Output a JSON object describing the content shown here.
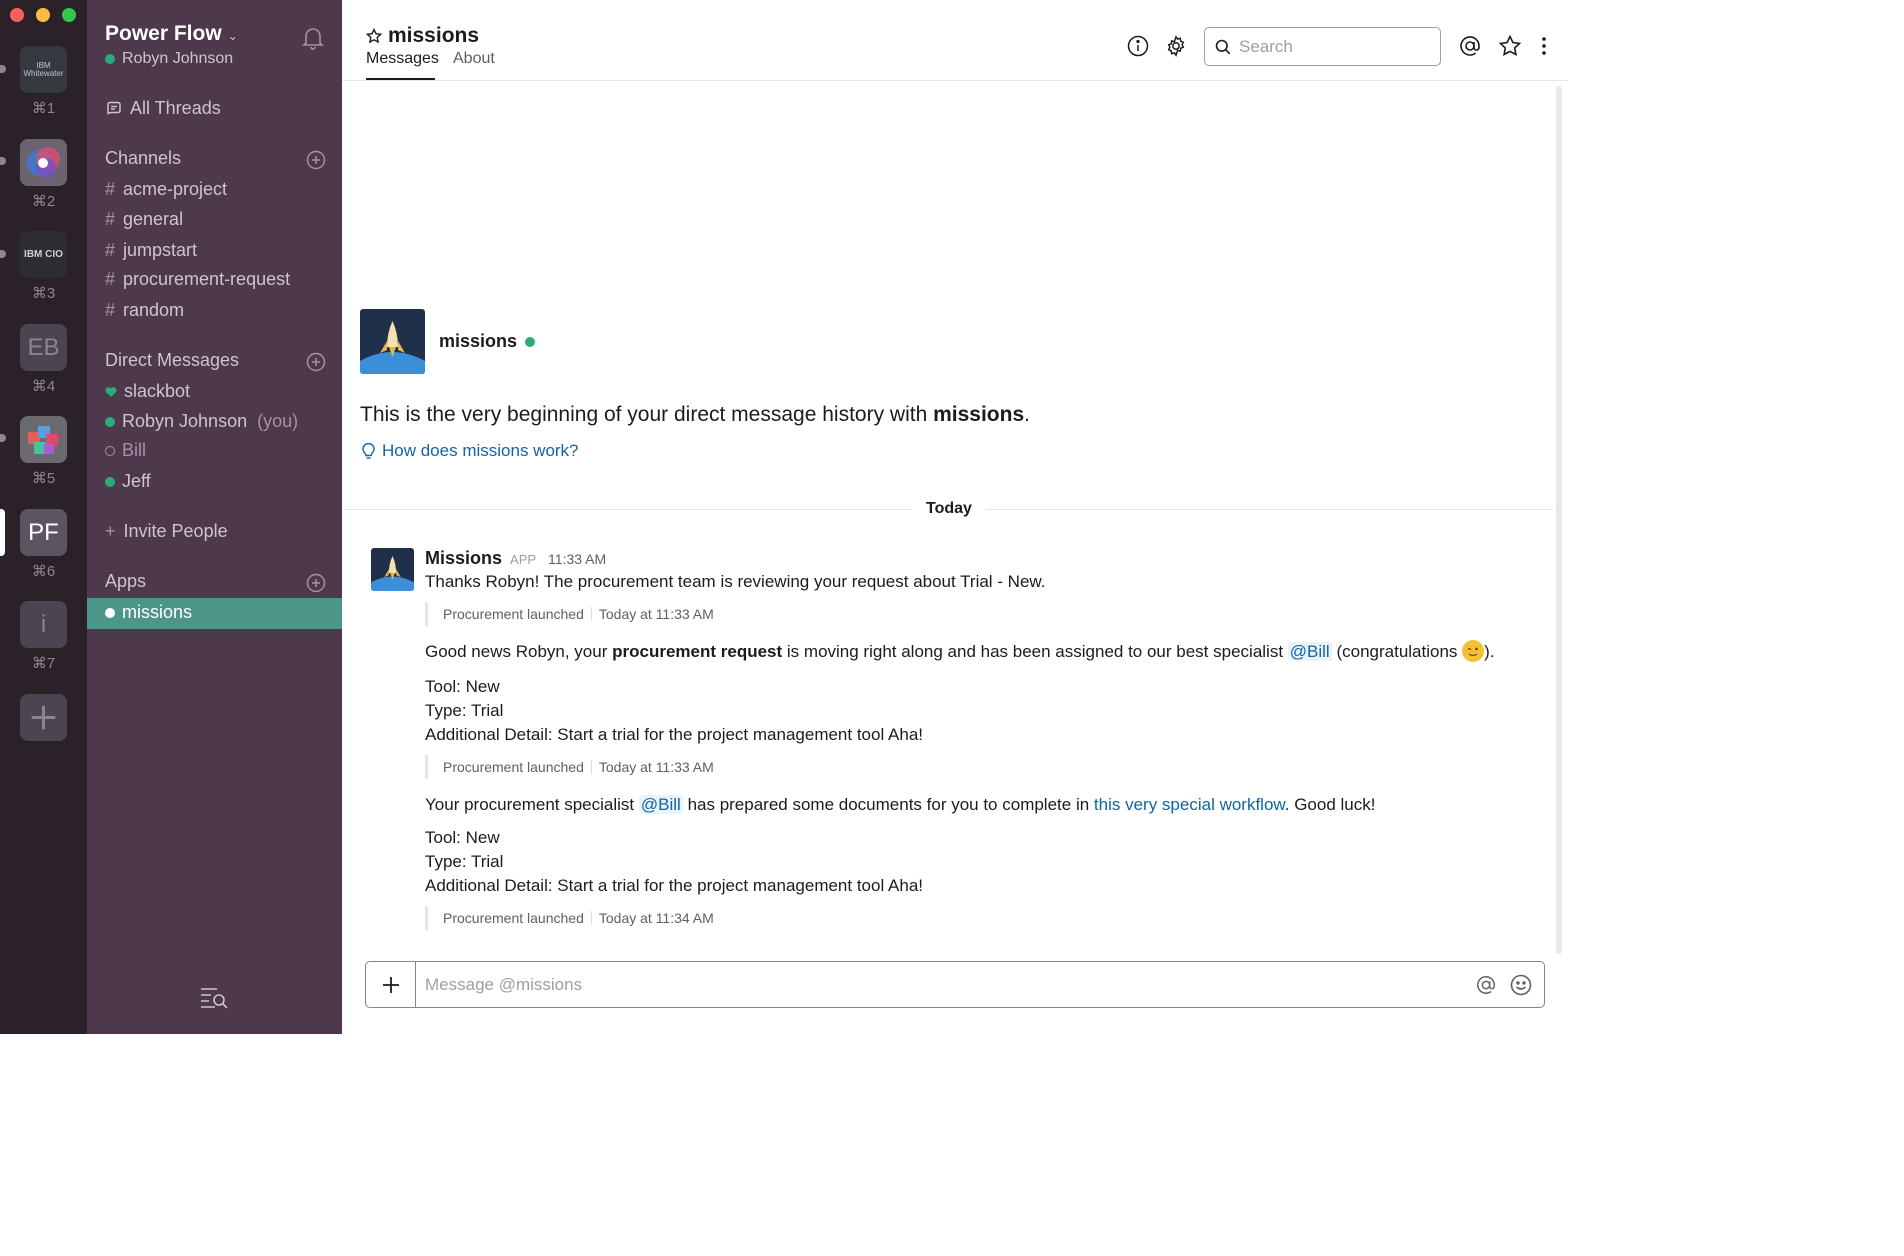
{
  "workspaces": [
    {
      "label": "IBM Whitewater",
      "shortcut": "⌘1"
    },
    {
      "label": "",
      "shortcut": "⌘2"
    },
    {
      "label": "IBM CIO",
      "shortcut": "⌘3"
    },
    {
      "label": "EB",
      "shortcut": "⌘4"
    },
    {
      "label": "",
      "shortcut": "⌘5"
    },
    {
      "label": "PF",
      "shortcut": "⌘6",
      "active": true
    },
    {
      "label": "i",
      "shortcut": "⌘7"
    }
  ],
  "team": {
    "name": "Power Flow",
    "user": "Robyn Johnson"
  },
  "sidebar": {
    "all_threads": "All Threads",
    "channels_header": "Channels",
    "channels": [
      "acme-project",
      "general",
      "jumpstart",
      "procurement-request",
      "random"
    ],
    "dm_header": "Direct Messages",
    "dms": [
      {
        "name": "slackbot",
        "status": "heart"
      },
      {
        "name": "Robyn Johnson",
        "suffix": "(you)",
        "status": "online"
      },
      {
        "name": "Bill",
        "status": "away"
      },
      {
        "name": "Jeff",
        "status": "online"
      }
    ],
    "invite": "Invite People",
    "apps_header": "Apps",
    "apps": [
      "missions"
    ]
  },
  "header": {
    "channel": "missions",
    "tabs": [
      "Messages",
      "About"
    ],
    "search_placeholder": "Search"
  },
  "intro": {
    "name": "missions",
    "text_prefix": "This is the very beginning of your direct message history with",
    "text_bold": "missions",
    "text_suffix": ".",
    "help_link": "How does missions work?"
  },
  "day_divider": "Today",
  "message": {
    "sender": "Missions",
    "badge": "APP",
    "time": "11:33 AM",
    "first_line": "Thanks Robyn! The procurement team is reviewing your request about Trial - New.",
    "context_label": "Procurement launched",
    "ctx_times": [
      "Today at 11:33 AM",
      "Today at 11:33 AM",
      "Today at 11:34 AM"
    ],
    "news": {
      "pre": "Good news Robyn, your",
      "bold": "procurement request",
      "mid": "is moving right along and has been assigned to our best specialist",
      "mention": "@Bill",
      "post_open": "(congratulations",
      "post_close": ")."
    },
    "tool_line": "Tool: New",
    "type_line": "Type: Trial",
    "detail_line": "Additional Detail: Start a trial for the project management tool Aha!",
    "docs": {
      "pre": "Your procurement specialist",
      "mention": "@Bill",
      "mid": "has prepared some documents for you to complete in",
      "link": "this very special workflow",
      "post": ". Good luck!"
    }
  },
  "composer": {
    "placeholder": "Message @missions"
  },
  "colors": {
    "sidebar": "#4d394b",
    "rail": "#2a2129",
    "active": "#4c9689",
    "online": "#2bac76",
    "link": "#1264a3"
  }
}
